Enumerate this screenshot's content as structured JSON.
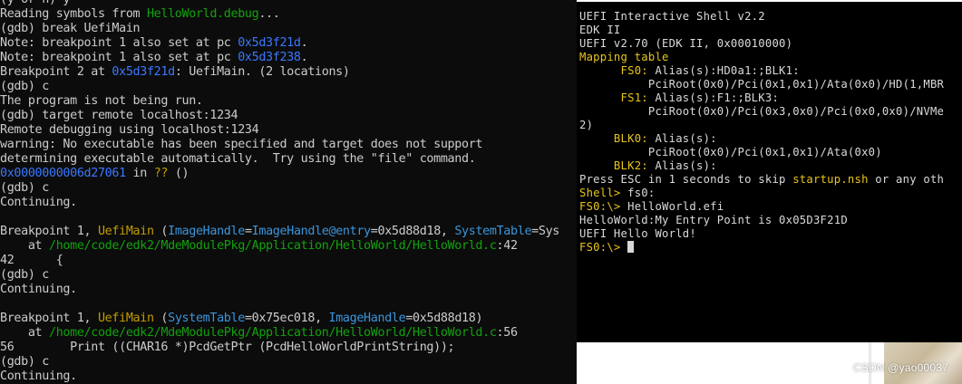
{
  "gdb_terminal": {
    "lines": [
      [
        {
          "t": "(y or n) y",
          "c": "default"
        }
      ],
      [
        {
          "t": "Reading symbols from ",
          "c": "default"
        },
        {
          "t": "HelloWorld.debug",
          "c": "green"
        },
        {
          "t": "...",
          "c": "default"
        }
      ],
      [
        {
          "t": "(gdb) break UefiMain",
          "c": "default"
        }
      ],
      [
        {
          "t": "Note: breakpoint 1 also set at pc ",
          "c": "default"
        },
        {
          "t": "0x5d3f21d",
          "c": "blue"
        },
        {
          "t": ".",
          "c": "default"
        }
      ],
      [
        {
          "t": "Note: breakpoint 1 also set at pc ",
          "c": "default"
        },
        {
          "t": "0x5d3f238",
          "c": "blue"
        },
        {
          "t": ".",
          "c": "default"
        }
      ],
      [
        {
          "t": "Breakpoint 2 at ",
          "c": "default"
        },
        {
          "t": "0x5d3f21d",
          "c": "blue"
        },
        {
          "t": ": UefiMain. (2 locations)",
          "c": "default"
        }
      ],
      [
        {
          "t": "(gdb) c",
          "c": "default"
        }
      ],
      [
        {
          "t": "The program is not being run.",
          "c": "default"
        }
      ],
      [
        {
          "t": "(gdb) target remote localhost:1234",
          "c": "default"
        }
      ],
      [
        {
          "t": "Remote debugging using localhost:1234",
          "c": "default"
        }
      ],
      [
        {
          "t": "warning: No executable has been specified and target does not support",
          "c": "default"
        }
      ],
      [
        {
          "t": "determining executable automatically.  Try using the \"file\" command.",
          "c": "default"
        }
      ],
      [
        {
          "t": "0x0000000006d27061",
          "c": "blue"
        },
        {
          "t": " in ",
          "c": "default"
        },
        {
          "t": "??",
          "c": "yellow"
        },
        {
          "t": " ()",
          "c": "default"
        }
      ],
      [
        {
          "t": "(gdb) c",
          "c": "default"
        }
      ],
      [
        {
          "t": "Continuing.",
          "c": "default"
        }
      ],
      [
        {
          "t": "",
          "c": "default"
        }
      ],
      [
        {
          "t": "Breakpoint 1, ",
          "c": "default"
        },
        {
          "t": "UefiMain",
          "c": "yellow"
        },
        {
          "t": " (",
          "c": "default"
        },
        {
          "t": "ImageHandle",
          "c": "teal"
        },
        {
          "t": "=",
          "c": "default"
        },
        {
          "t": "ImageHandle@entry",
          "c": "teal"
        },
        {
          "t": "=0x5d88d18, ",
          "c": "default"
        },
        {
          "t": "SystemTable",
          "c": "teal"
        },
        {
          "t": "=Sys",
          "c": "default"
        }
      ],
      [
        {
          "t": "    at ",
          "c": "default"
        },
        {
          "t": "/home/code/edk2/MdeModulePkg/Application/HelloWorld/HelloWorld.c",
          "c": "green"
        },
        {
          "t": ":42",
          "c": "default"
        }
      ],
      [
        {
          "t": "42      {",
          "c": "default"
        }
      ],
      [
        {
          "t": "(gdb) c",
          "c": "default"
        }
      ],
      [
        {
          "t": "Continuing.",
          "c": "default"
        }
      ],
      [
        {
          "t": "",
          "c": "default"
        }
      ],
      [
        {
          "t": "Breakpoint 1, ",
          "c": "default"
        },
        {
          "t": "UefiMain",
          "c": "yellow"
        },
        {
          "t": " (",
          "c": "default"
        },
        {
          "t": "SystemTable",
          "c": "teal"
        },
        {
          "t": "=0x75ec018, ",
          "c": "default"
        },
        {
          "t": "ImageHandle",
          "c": "teal"
        },
        {
          "t": "=0x5d88d18)",
          "c": "default"
        }
      ],
      [
        {
          "t": "    at ",
          "c": "default"
        },
        {
          "t": "/home/code/edk2/MdeModulePkg/Application/HelloWorld/HelloWorld.c",
          "c": "green"
        },
        {
          "t": ":56",
          "c": "default"
        }
      ],
      [
        {
          "t": "56        Print ((CHAR16 *)PcdGetPtr (PcdHelloWorldPrintString));",
          "c": "default"
        }
      ],
      [
        {
          "t": "(gdb) c",
          "c": "default"
        }
      ],
      [
        {
          "t": "Continuing.",
          "c": "default"
        }
      ]
    ]
  },
  "uefi_shell": {
    "lines": [
      [
        {
          "t": "UEFI Interactive Shell v2.2",
          "c": "white"
        }
      ],
      [
        {
          "t": "EDK II",
          "c": "white"
        }
      ],
      [
        {
          "t": "UEFI v2.70 (EDK II, 0x00010000)",
          "c": "white"
        }
      ],
      [
        {
          "t": "Mapping table",
          "c": "yellow"
        }
      ],
      [
        {
          "t": "      FS0:",
          "c": "yellow"
        },
        {
          "t": " Alias(s):HD0a1:;BLK1:",
          "c": "white"
        }
      ],
      [
        {
          "t": "          PciRoot(0x0)/Pci(0x1,0x1)/Ata(0x0)/HD(1,MBR",
          "c": "white"
        }
      ],
      [
        {
          "t": "      FS1:",
          "c": "yellow"
        },
        {
          "t": " Alias(s):F1:;BLK3:",
          "c": "white"
        }
      ],
      [
        {
          "t": "          PciRoot(0x0)/Pci(0x3,0x0)/Pci(0x0,0x0)/NVMe",
          "c": "white"
        }
      ],
      [
        {
          "t": "2)",
          "c": "white"
        }
      ],
      [
        {
          "t": "     BLK0:",
          "c": "yellow"
        },
        {
          "t": " Alias(s):",
          "c": "white"
        }
      ],
      [
        {
          "t": "          PciRoot(0x0)/Pci(0x1,0x1)/Ata(0x0)",
          "c": "white"
        }
      ],
      [
        {
          "t": "     BLK2:",
          "c": "yellow"
        },
        {
          "t": " Alias(s):",
          "c": "white"
        }
      ],
      [
        {
          "t": "Press ESC in 1 seconds to skip ",
          "c": "white"
        },
        {
          "t": "startup.nsh",
          "c": "yellow"
        },
        {
          "t": " or any oth",
          "c": "white"
        }
      ],
      [
        {
          "t": "Shell>",
          "c": "yellow"
        },
        {
          "t": " fs0:",
          "c": "white"
        }
      ],
      [
        {
          "t": "FS0:\\>",
          "c": "yellow"
        },
        {
          "t": " HelloWorld.efi",
          "c": "white"
        }
      ],
      [
        {
          "t": "HelloWorld:My Entry Point is 0x05D3F21D",
          "c": "white"
        }
      ],
      [
        {
          "t": "UEFI Hello World!",
          "c": "white"
        }
      ],
      [
        {
          "t": "FS0:\\>",
          "c": "yellow"
        },
        {
          "t": " ",
          "c": "white"
        }
      ]
    ]
  },
  "watermark": "CSDN @yao00037",
  "colors": {
    "terminal_bg": "#0c0c0c",
    "terminal_fg": "#cccccc",
    "gdb_green": "#13a10e",
    "gdb_blue": "#3b78ff",
    "gdb_yellow": "#c19c00",
    "gdb_teal": "#3a96dd",
    "uefi_bg": "#000000",
    "uefi_yellow": "#e8c51a"
  }
}
